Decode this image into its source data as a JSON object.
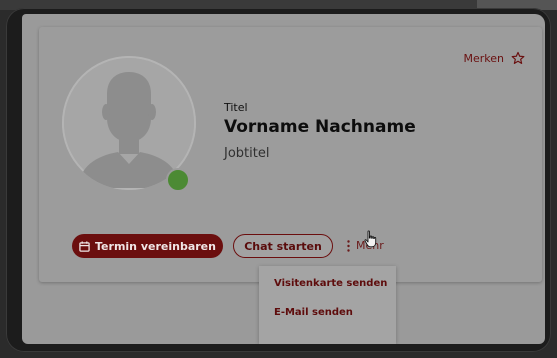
{
  "card": {
    "title_small": "Titel",
    "name": "Vorname Nachname",
    "job_title": "Jobtitel",
    "bookmark_label": "Merken",
    "online_status_color": "#4c8a34"
  },
  "actions": {
    "primary_label": "Termin vereinbaren",
    "secondary_label": "Chat starten",
    "more_label": "Mehr"
  },
  "dropdown": {
    "items": [
      "Visitenkarte senden",
      "E-Mail senden"
    ]
  },
  "icons": {
    "bookmark": "star-outline-icon",
    "calendar": "calendar-icon",
    "more": "vertical-dots-icon",
    "cursor": "hand-pointer-icon",
    "avatar": "person-silhouette-icon"
  },
  "colors": {
    "accent": "#6b0e0e"
  }
}
